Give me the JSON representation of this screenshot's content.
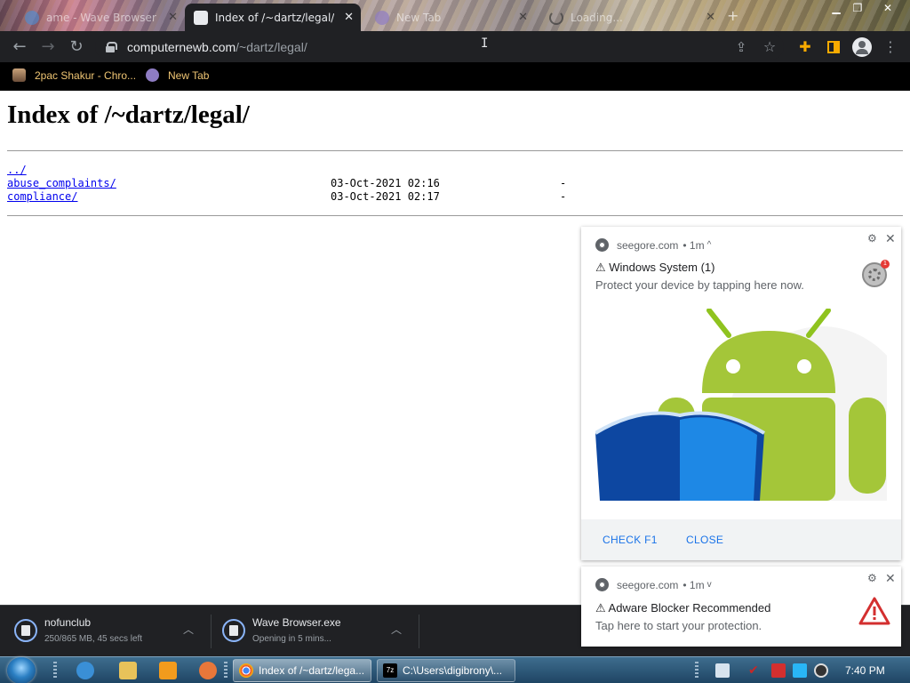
{
  "tabs": [
    {
      "title": "Wave Browser",
      "partial_title": "ame - Wave Browser",
      "active": false
    },
    {
      "title": "Index of /~dartz/legal/",
      "active": true
    },
    {
      "title": "New Tab",
      "partial_title": "New Tab",
      "active": false
    },
    {
      "title": "Loading...",
      "active": false
    }
  ],
  "toolbar": {
    "url_host": "computernewb.com",
    "url_path": "/~dartz/legal/"
  },
  "bookmarks": [
    {
      "label": "2pac Shakur - Chro..."
    },
    {
      "label": "New Tab"
    }
  ],
  "page": {
    "title": "Index of /~dartz/legal/",
    "entries": [
      {
        "name": "../",
        "date": "",
        "size": ""
      },
      {
        "name": "abuse_complaints/",
        "date": "03-Oct-2021 02:16",
        "size": "-"
      },
      {
        "name": "compliance/",
        "date": "03-Oct-2021 02:17",
        "size": "-"
      }
    ]
  },
  "notifications": [
    {
      "origin": "seegore.com",
      "time": "• 1m",
      "chevron": "^",
      "title": "⚠ Windows System (1)",
      "body": "Protect your device by tapping here now.",
      "badge": "1",
      "actions": [
        "CHECK F1",
        "CLOSE"
      ]
    },
    {
      "origin": "seegore.com",
      "time": "• 1m",
      "chevron": "v",
      "title": "⚠ Adware Blocker Recommended",
      "body": "Tap here to start your protection."
    }
  ],
  "downloads": [
    {
      "name": "nofunclub",
      "status": "250/865 MB, 45 secs left"
    },
    {
      "name": "Wave Browser.exe",
      "status": "Opening in 5 mins..."
    }
  ],
  "taskbar": {
    "tasks": [
      {
        "label": "Index of /~dartz/lega..."
      },
      {
        "label": "C:\\Users\\digibrony\\..."
      }
    ],
    "clock": "7:40 PM"
  },
  "colors": {
    "chrome_dark": "#202124",
    "link": "#0000ee",
    "notif_action": "#1a73e8",
    "android_green": "#a4c639"
  }
}
